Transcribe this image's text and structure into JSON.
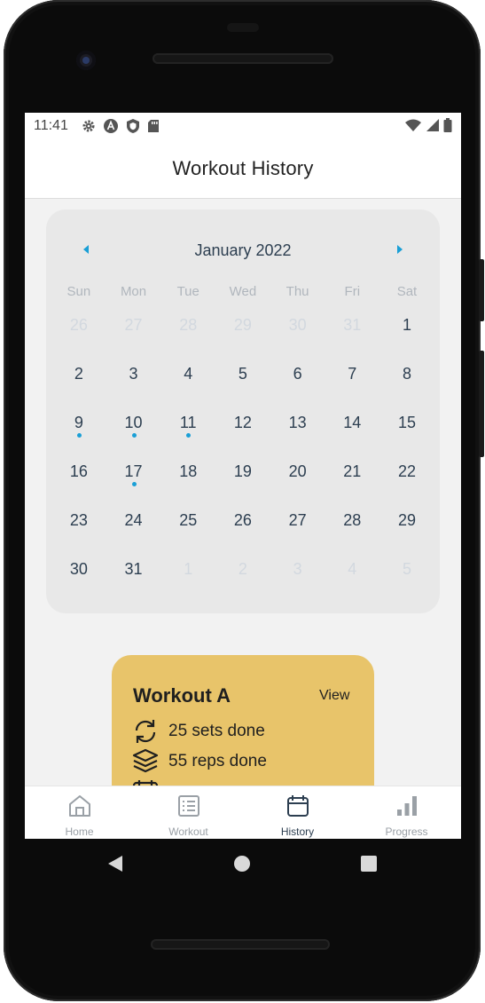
{
  "status_bar": {
    "time": "11:41",
    "left_icons": [
      "gear-icon",
      "a-icon",
      "shield-icon",
      "sd-card-icon"
    ],
    "right_icons": [
      "wifi-icon",
      "signal-icon",
      "battery-icon"
    ]
  },
  "header": {
    "title": "Workout History"
  },
  "calendar": {
    "month_label": "January 2022",
    "weekdays": [
      "Sun",
      "Mon",
      "Tue",
      "Wed",
      "Thu",
      "Fri",
      "Sat"
    ],
    "accent_color": "#1a9fd6",
    "days": [
      {
        "label": "26",
        "in_month": false,
        "has_workout": false
      },
      {
        "label": "27",
        "in_month": false,
        "has_workout": false
      },
      {
        "label": "28",
        "in_month": false,
        "has_workout": false
      },
      {
        "label": "29",
        "in_month": false,
        "has_workout": false
      },
      {
        "label": "30",
        "in_month": false,
        "has_workout": false
      },
      {
        "label": "31",
        "in_month": false,
        "has_workout": false
      },
      {
        "label": "1",
        "in_month": true,
        "has_workout": false
      },
      {
        "label": "2",
        "in_month": true,
        "has_workout": false
      },
      {
        "label": "3",
        "in_month": true,
        "has_workout": false
      },
      {
        "label": "4",
        "in_month": true,
        "has_workout": false
      },
      {
        "label": "5",
        "in_month": true,
        "has_workout": false
      },
      {
        "label": "6",
        "in_month": true,
        "has_workout": false
      },
      {
        "label": "7",
        "in_month": true,
        "has_workout": false
      },
      {
        "label": "8",
        "in_month": true,
        "has_workout": false
      },
      {
        "label": "9",
        "in_month": true,
        "has_workout": true
      },
      {
        "label": "10",
        "in_month": true,
        "has_workout": true
      },
      {
        "label": "11",
        "in_month": true,
        "has_workout": true
      },
      {
        "label": "12",
        "in_month": true,
        "has_workout": false
      },
      {
        "label": "13",
        "in_month": true,
        "has_workout": false
      },
      {
        "label": "14",
        "in_month": true,
        "has_workout": false
      },
      {
        "label": "15",
        "in_month": true,
        "has_workout": false
      },
      {
        "label": "16",
        "in_month": true,
        "has_workout": false
      },
      {
        "label": "17",
        "in_month": true,
        "has_workout": true
      },
      {
        "label": "18",
        "in_month": true,
        "has_workout": false
      },
      {
        "label": "19",
        "in_month": true,
        "has_workout": false
      },
      {
        "label": "20",
        "in_month": true,
        "has_workout": false
      },
      {
        "label": "21",
        "in_month": true,
        "has_workout": false
      },
      {
        "label": "22",
        "in_month": true,
        "has_workout": false
      },
      {
        "label": "23",
        "in_month": true,
        "has_workout": false
      },
      {
        "label": "24",
        "in_month": true,
        "has_workout": false
      },
      {
        "label": "25",
        "in_month": true,
        "has_workout": false
      },
      {
        "label": "26",
        "in_month": true,
        "has_workout": false
      },
      {
        "label": "27",
        "in_month": true,
        "has_workout": false
      },
      {
        "label": "28",
        "in_month": true,
        "has_workout": false
      },
      {
        "label": "29",
        "in_month": true,
        "has_workout": false
      },
      {
        "label": "30",
        "in_month": true,
        "has_workout": false
      },
      {
        "label": "31",
        "in_month": true,
        "has_workout": false
      },
      {
        "label": "1",
        "in_month": false,
        "has_workout": false
      },
      {
        "label": "2",
        "in_month": false,
        "has_workout": false
      },
      {
        "label": "3",
        "in_month": false,
        "has_workout": false
      },
      {
        "label": "4",
        "in_month": false,
        "has_workout": false
      },
      {
        "label": "5",
        "in_month": false,
        "has_workout": false
      }
    ]
  },
  "workout_card": {
    "title": "Workout A",
    "view_label": "View",
    "background": "#e8c46a",
    "sets_text": "25 sets done",
    "reps_text": "55 reps done"
  },
  "tabs": [
    {
      "label": "Home",
      "icon": "home-icon",
      "active": false
    },
    {
      "label": "Workout",
      "icon": "list-icon",
      "active": false
    },
    {
      "label": "History",
      "icon": "calendar-icon",
      "active": true
    },
    {
      "label": "Progress",
      "icon": "bar-chart-icon",
      "active": false
    }
  ],
  "system_nav": [
    "back-icon",
    "home-circle-icon",
    "recents-square-icon"
  ]
}
